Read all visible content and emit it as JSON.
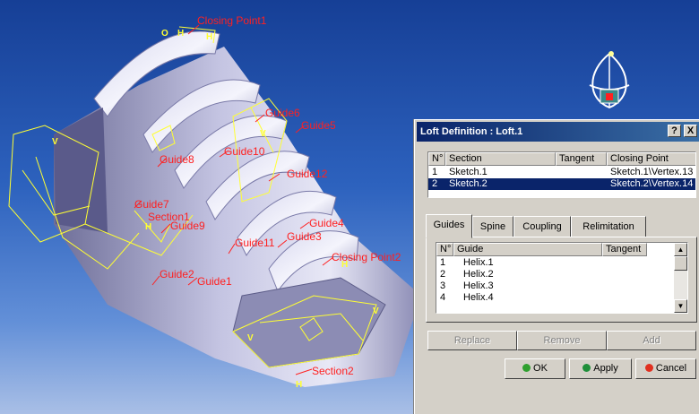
{
  "viewport": {
    "labels": {
      "closing_point_1": "Closing Point1",
      "guide6": "Guide6",
      "guide5": "Guide5",
      "guide8": "Guide8",
      "guide10": "Guide10",
      "guide12": "Guide12",
      "guide4": "Guide4",
      "guide7": "Guide7",
      "section1": "Section1",
      "guide9": "Guide9",
      "guide11": "Guide11",
      "guide3": "Guide3",
      "closing_point_2": "Closing Point2",
      "guide2": "Guide2",
      "guide1": "Guide1",
      "section2": "Section2"
    },
    "glyphs": {
      "h": "H",
      "v": "V",
      "circle": "O"
    }
  },
  "dialog": {
    "title": "Loft Definition : Loft.1",
    "help_label": "?",
    "close_label": "X",
    "sections_table": {
      "headers": [
        "N°",
        "Section",
        "Tangent",
        "Closing Point"
      ],
      "rows": [
        {
          "n": "1",
          "section": "Sketch.1",
          "tangent": "",
          "closing": "Sketch.1\\Vertex.13"
        },
        {
          "n": "2",
          "section": "Sketch.2",
          "tangent": "",
          "closing": "Sketch.2\\Vertex.14"
        }
      ],
      "selected_row": 2
    },
    "tabs": [
      "Guides",
      "Spine",
      "Coupling",
      "Relimitation"
    ],
    "active_tab": "Guides",
    "guides_table": {
      "headers": [
        "N°",
        "Guide",
        "Tangent"
      ],
      "rows": [
        {
          "n": "1",
          "guide": "Helix.1",
          "tangent": ""
        },
        {
          "n": "2",
          "guide": "Helix.2",
          "tangent": ""
        },
        {
          "n": "3",
          "guide": "Helix.3",
          "tangent": ""
        },
        {
          "n": "4",
          "guide": "Helix.4",
          "tangent": ""
        }
      ]
    },
    "buttons": {
      "replace": "Replace",
      "remove": "Remove",
      "add": "Add",
      "ok": "OK",
      "apply": "Apply",
      "cancel": "Cancel"
    },
    "colors": {
      "ok_icon": "#2fa02f",
      "apply_icon": "#1f8f3a",
      "cancel_icon": "#e03020"
    }
  },
  "compass": {
    "icon": "compass-icon"
  }
}
